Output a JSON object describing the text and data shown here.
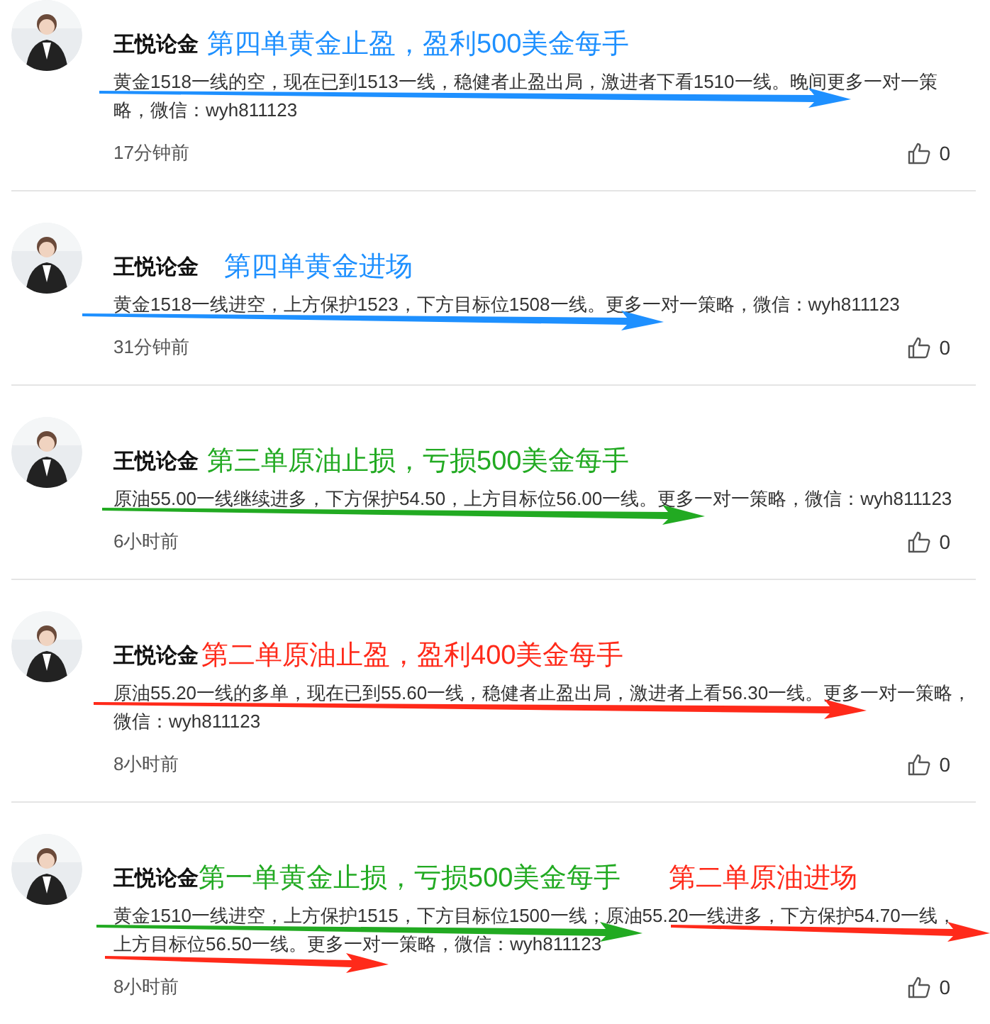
{
  "posts": [
    {
      "author": "王悦论金",
      "annotations": [
        {
          "text": "第四单黄金止盈，盈利500美金每手",
          "color": "#1e90ff"
        }
      ],
      "body": "黄金1518一线的空，现在已到1513一线，稳健者止盈出局，激进者下看1510一线。晚间更多一对一策略，微信：wyh811123",
      "arrows": [
        {
          "color": "#1e90ff"
        }
      ],
      "time": "17分钟前",
      "likes": "0"
    },
    {
      "author": "王悦论金",
      "annotations": [
        {
          "text": "第四单黄金进场",
          "color": "#1e90ff"
        }
      ],
      "body": "黄金1518一线进空，上方保护1523，下方目标位1508一线。更多一对一策略，微信：wyh811123",
      "arrows": [
        {
          "color": "#1e90ff"
        }
      ],
      "time": "31分钟前",
      "likes": "0"
    },
    {
      "author": "王悦论金",
      "annotations": [
        {
          "text": "第三单原油止损，亏损500美金每手",
          "color": "#22aa22"
        }
      ],
      "body": "原油55.00一线继续进多，下方保护54.50，上方目标位56.00一线。更多一对一策略，微信：wyh811123",
      "arrows": [
        {
          "color": "#22aa22"
        }
      ],
      "time": "6小时前",
      "likes": "0"
    },
    {
      "author": "王悦论金",
      "annotations": [
        {
          "text": "第二单原油止盈，盈利400美金每手",
          "color": "#ff2a1a"
        }
      ],
      "body": "原油55.20一线的多单，现在已到55.60一线，稳健者止盈出局，激进者上看56.30一线。更多一对一策略，微信：wyh811123",
      "arrows": [
        {
          "color": "#ff2a1a"
        }
      ],
      "time": "8小时前",
      "likes": "0"
    },
    {
      "author": "王悦论金",
      "annotations": [
        {
          "text": "第一单黄金止损，亏损500美金每手",
          "color": "#22aa22"
        },
        {
          "text": "第二单原油进场",
          "color": "#ff2a1a"
        }
      ],
      "body": "黄金1510一线进空，上方保护1515，下方目标位1500一线；原油55.20一线进多，下方保护54.70一线，上方目标位56.50一线。更多一对一策略，微信：wyh811123",
      "arrows": [
        {
          "color": "#22aa22"
        },
        {
          "color": "#ff2a1a"
        },
        {
          "color": "#ff2a1a"
        }
      ],
      "time": "8小时前",
      "likes": "0"
    }
  ]
}
